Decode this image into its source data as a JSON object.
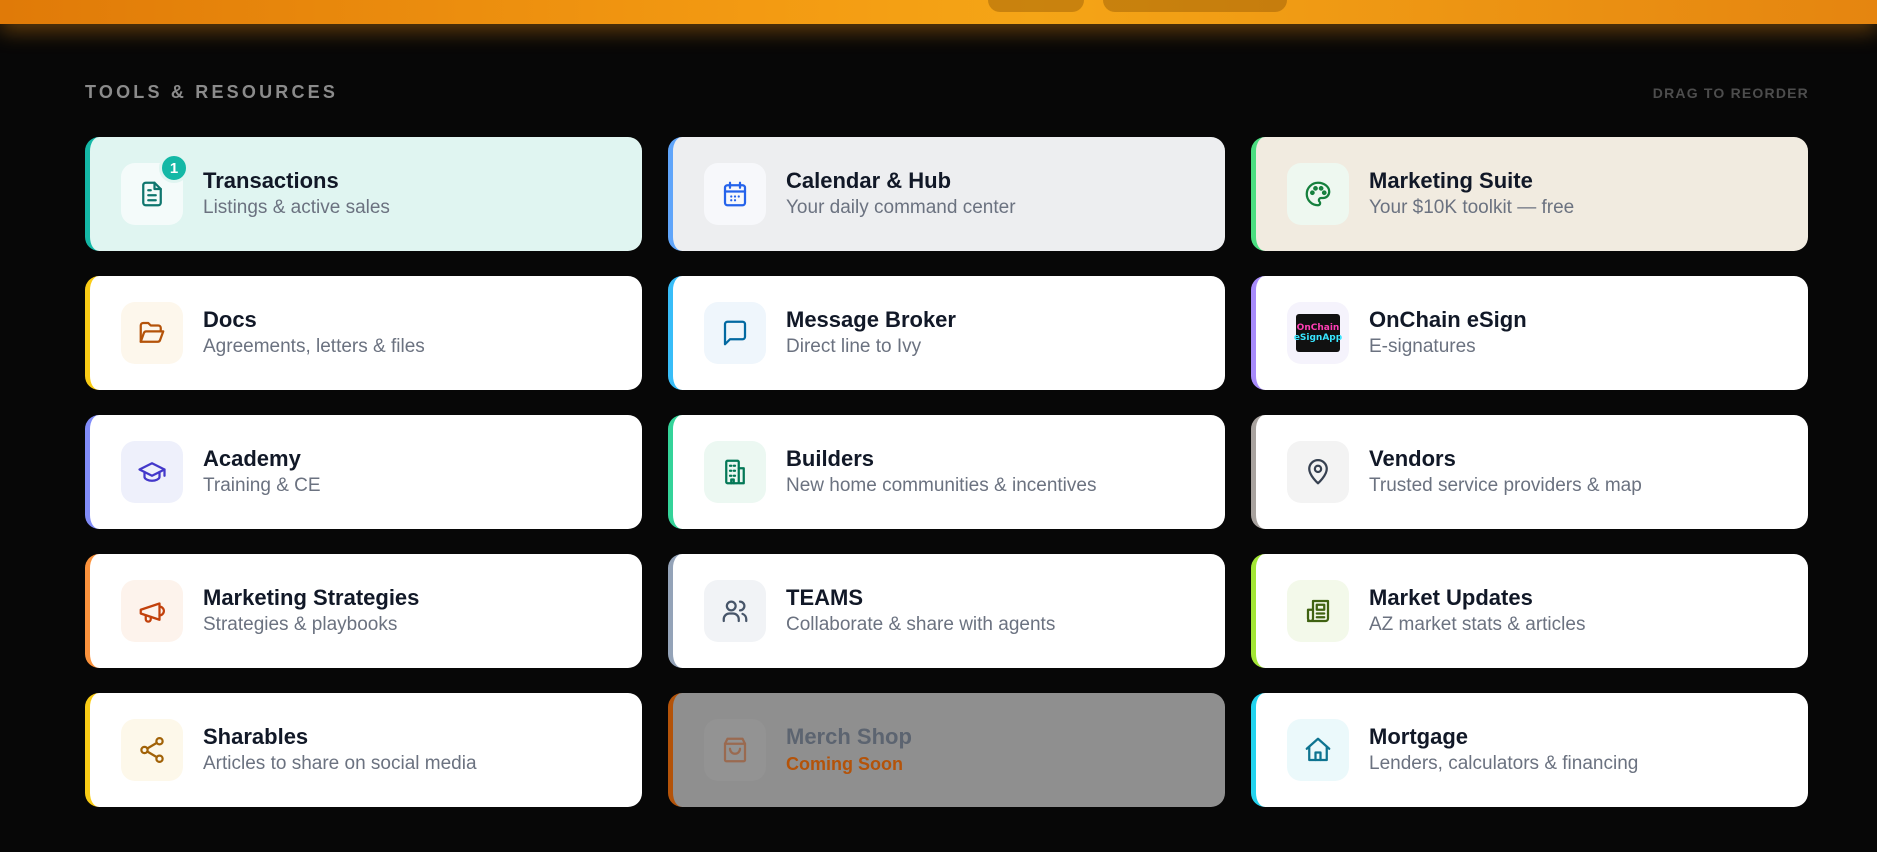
{
  "section": {
    "title": "TOOLS & RESOURCES",
    "drag_hint": "DRAG TO REORDER"
  },
  "cards": [
    {
      "title": "Transactions",
      "subtitle": "Listings & active sales",
      "icon": "document-icon",
      "accent": "#14b8a6",
      "bg": "#e0f5f1",
      "icon_bg": "#f4fbfa",
      "icon_color": "#0f766e",
      "badge": "1"
    },
    {
      "title": "Calendar & Hub",
      "subtitle": "Your daily command center",
      "icon": "calendar-icon",
      "accent": "#60a5fa",
      "bg": "#edeef0",
      "icon_bg": "#f7f8fb",
      "icon_color": "#2563eb"
    },
    {
      "title": "Marketing Suite",
      "subtitle": "Your $10K toolkit — free",
      "icon": "palette-icon",
      "accent": "#4ade80",
      "bg": "#f1ebe0",
      "icon_bg": "#eef8f0",
      "icon_color": "#15803d"
    },
    {
      "title": "Docs",
      "subtitle": "Agreements, letters & files",
      "icon": "folder-icon",
      "accent": "#facc15",
      "bg": "#ffffff",
      "icon_bg": "#fdf7ec",
      "icon_color": "#b45309"
    },
    {
      "title": "Message Broker",
      "subtitle": "Direct line to Ivy",
      "icon": "chat-icon",
      "accent": "#38bdf8",
      "bg": "#ffffff",
      "icon_bg": "#eff6fc",
      "icon_color": "#0369a1"
    },
    {
      "title": "OnChain eSign",
      "subtitle": "E-signatures",
      "icon": "esign-logo-icon",
      "accent": "#a78bfa",
      "bg": "#ffffff",
      "icon_bg": "#f5f3fc",
      "icon_color": "#7c3aed",
      "logo_line1": "OnChain",
      "logo_line2": "eSignApp"
    },
    {
      "title": "Academy",
      "subtitle": "Training & CE",
      "icon": "graduation-cap-icon",
      "accent": "#818cf8",
      "bg": "#ffffff",
      "icon_bg": "#eef0fb",
      "icon_color": "#4338ca"
    },
    {
      "title": "Builders",
      "subtitle": "New home communities & incentives",
      "icon": "building-icon",
      "accent": "#34d399",
      "bg": "#ffffff",
      "icon_bg": "#ecf8f2",
      "icon_color": "#047857"
    },
    {
      "title": "Vendors",
      "subtitle": "Trusted service providers & map",
      "icon": "map-pin-icon",
      "accent": "#a8a29e",
      "bg": "#ffffff",
      "icon_bg": "#f3f3f3",
      "icon_color": "#374151"
    },
    {
      "title": "Marketing Strategies",
      "subtitle": "Strategies & playbooks",
      "icon": "megaphone-icon",
      "accent": "#fb923c",
      "bg": "#ffffff",
      "icon_bg": "#fdf3ec",
      "icon_color": "#c2410c"
    },
    {
      "title": "TEAMS",
      "subtitle": "Collaborate & share with agents",
      "icon": "users-icon",
      "accent": "#94a3b8",
      "bg": "#ffffff",
      "icon_bg": "#f1f3f6",
      "icon_color": "#475569"
    },
    {
      "title": "Market Updates",
      "subtitle": "AZ market stats & articles",
      "icon": "newspaper-icon",
      "accent": "#a3e635",
      "bg": "#ffffff",
      "icon_bg": "#f3f9ea",
      "icon_color": "#3f6212"
    },
    {
      "title": "Sharables",
      "subtitle": "Articles to share on social media",
      "icon": "share-icon",
      "accent": "#facc15",
      "bg": "#ffffff",
      "icon_bg": "#fdf8ea",
      "icon_color": "#a16207"
    },
    {
      "title": "Merch Shop",
      "subtitle": "Coming Soon",
      "icon": "shopping-bag-icon",
      "accent": "#b45309",
      "bg": "#8f8f8f",
      "icon_bg": "#939393",
      "icon_color": "#9a6a50",
      "disabled": true
    },
    {
      "title": "Mortgage",
      "subtitle": "Lenders, calculators & financing",
      "icon": "home-icon",
      "accent": "#22d3ee",
      "bg": "#ffffff",
      "icon_bg": "#ebf9fb",
      "icon_color": "#0e7490"
    }
  ]
}
